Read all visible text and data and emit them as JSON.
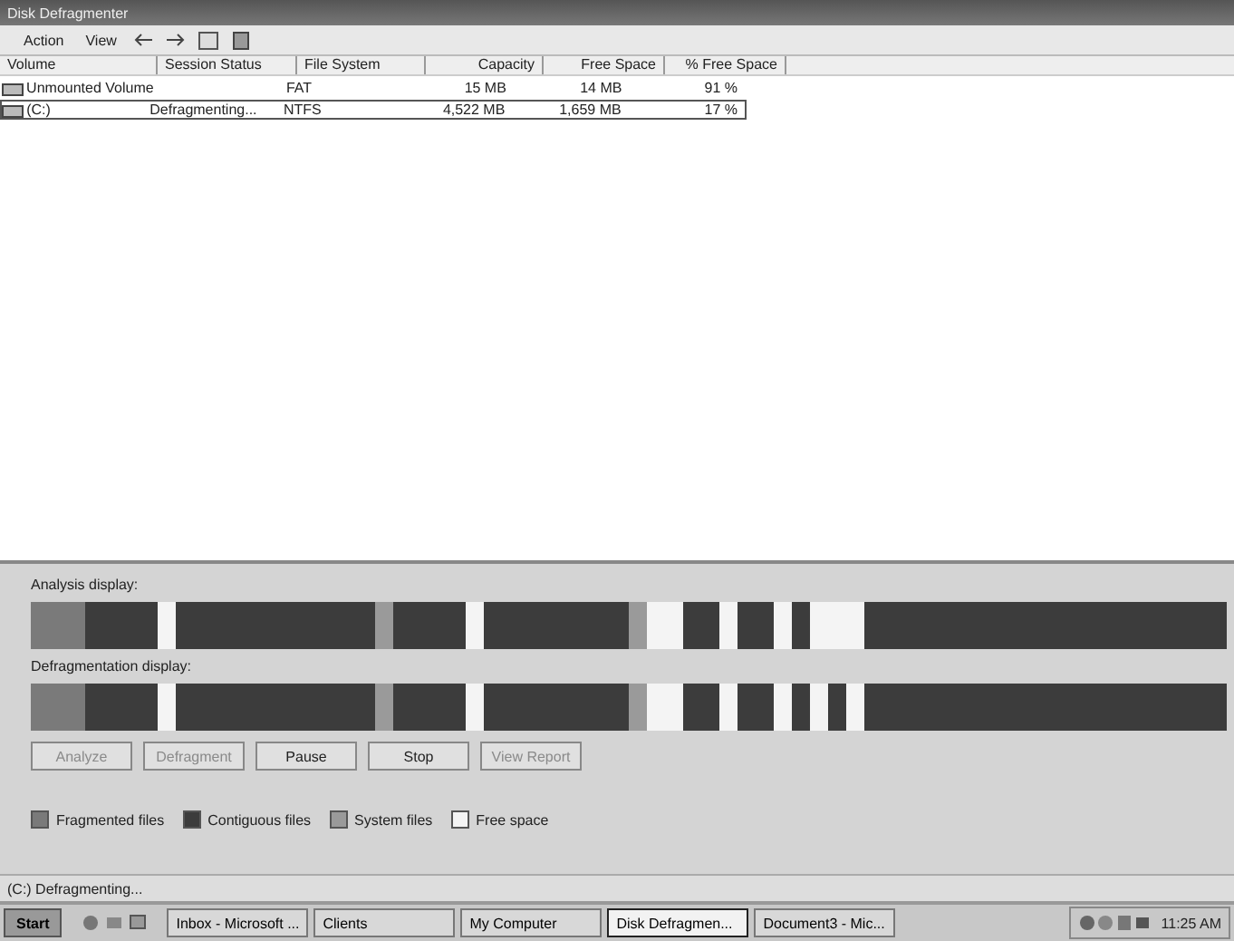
{
  "window": {
    "title": "Disk Defragmenter"
  },
  "menu": [
    "Action",
    "View"
  ],
  "table": {
    "columns": [
      "Volume",
      "Session Status",
      "File System",
      "Capacity",
      "Free Space",
      "% Free Space"
    ],
    "rows": [
      {
        "cells": [
          "Unmounted Volume",
          "",
          "FAT",
          "15 MB",
          "14 MB",
          "91 %"
        ],
        "selected": false
      },
      {
        "cells": [
          "(C:)",
          "Defragmenting...",
          "NTFS",
          "4,522 MB",
          "1,659 MB",
          "17 %"
        ],
        "selected": true
      }
    ]
  },
  "displays": [
    {
      "label": "Analysis display:"
    },
    {
      "label": "Defragmentation display:"
    }
  ],
  "buttons": [
    {
      "label": "Analyze",
      "disabled": true
    },
    {
      "label": "Defragment",
      "disabled": true
    },
    {
      "label": "Pause",
      "disabled": false
    },
    {
      "label": "Stop",
      "disabled": false
    },
    {
      "label": "View Report",
      "disabled": true
    }
  ],
  "legend": [
    {
      "kind": "fragmented",
      "label": "Fragmented files"
    },
    {
      "kind": "contiguous",
      "label": "Contiguous files"
    },
    {
      "kind": "system",
      "label": "System files"
    },
    {
      "kind": "free",
      "label": "Free space"
    }
  ],
  "status_bar": "(C:) Defragmenting...",
  "taskbar": {
    "start": "Start",
    "tasks": [
      {
        "label": "Inbox - Microsoft ...",
        "selected": false
      },
      {
        "label": "Clients",
        "selected": false
      },
      {
        "label": "My Computer",
        "selected": false
      },
      {
        "label": "Disk Defragmen...",
        "selected": true
      },
      {
        "label": "Document3 - Mic...",
        "selected": false
      }
    ],
    "clock": "11:25 AM"
  }
}
